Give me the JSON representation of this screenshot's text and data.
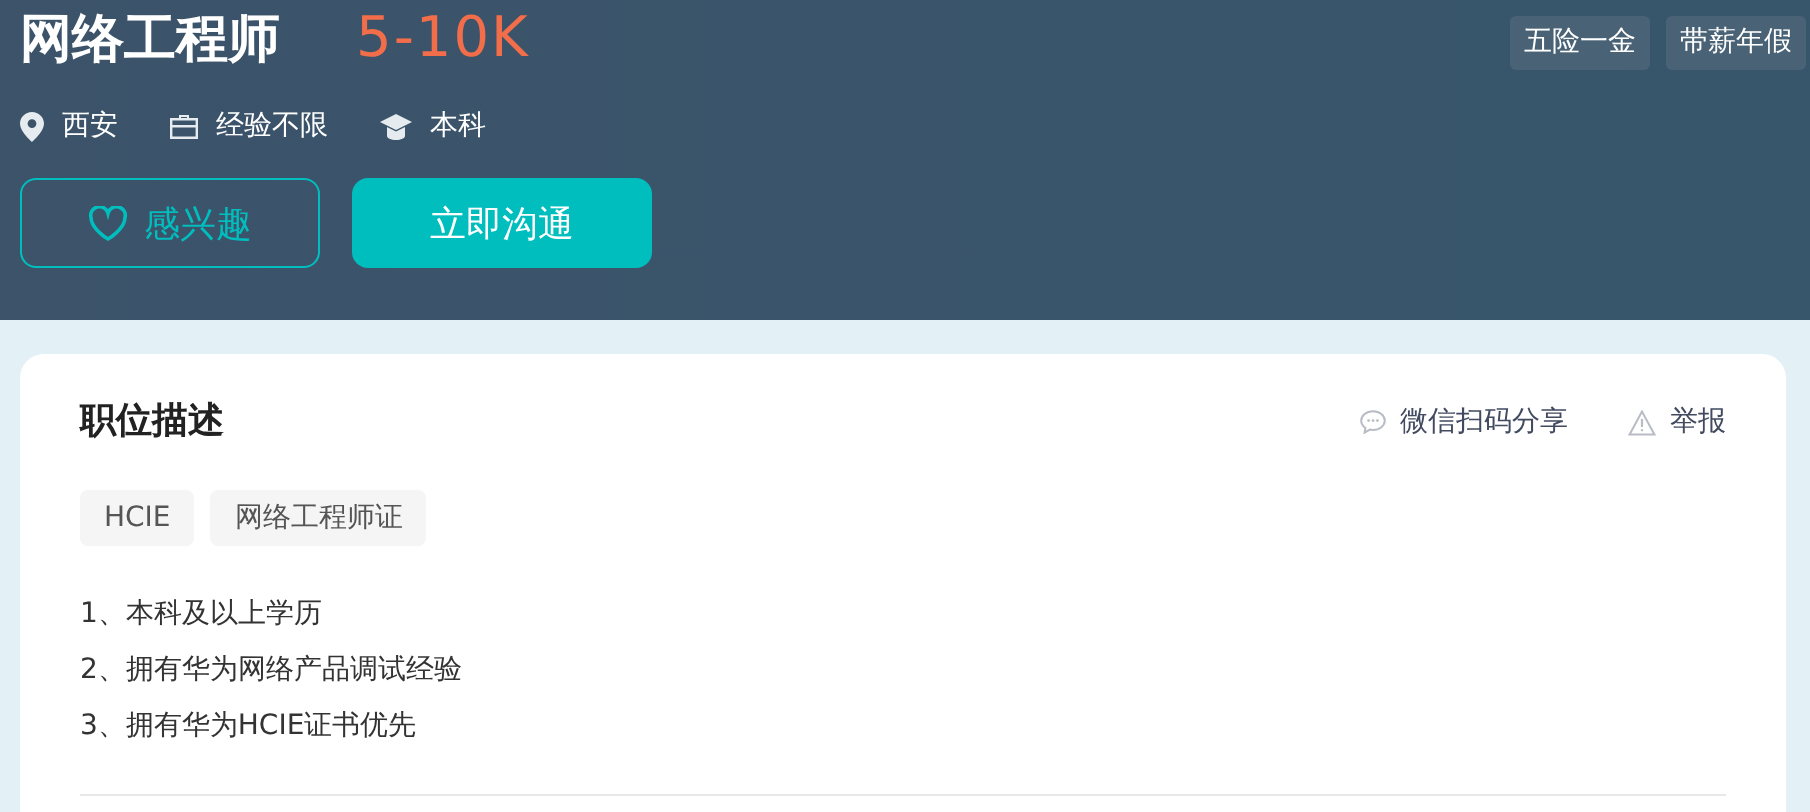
{
  "job": {
    "title": "网络工程师",
    "salary": "5-10K",
    "benefits": [
      "五险一金",
      "带薪年假"
    ],
    "meta": [
      {
        "kind": "location",
        "text": "西安"
      },
      {
        "kind": "experience",
        "text": "经验不限"
      },
      {
        "kind": "education",
        "text": "本科"
      }
    ],
    "buttons": [
      {
        "kind": "interest",
        "label": "感兴趣"
      },
      {
        "kind": "chat",
        "label": "立即沟通"
      }
    ]
  },
  "description": {
    "heading": "职位描述",
    "actions": [
      {
        "kind": "share",
        "label": "微信扫码分享"
      },
      {
        "kind": "report",
        "label": "举报"
      }
    ],
    "tags": [
      "HCIE",
      "网络工程师证"
    ],
    "lines": [
      "1、本科及以上学历",
      "2、拥有华为网络产品调试经验",
      "3、拥有华为HCIE证书优先"
    ]
  }
}
